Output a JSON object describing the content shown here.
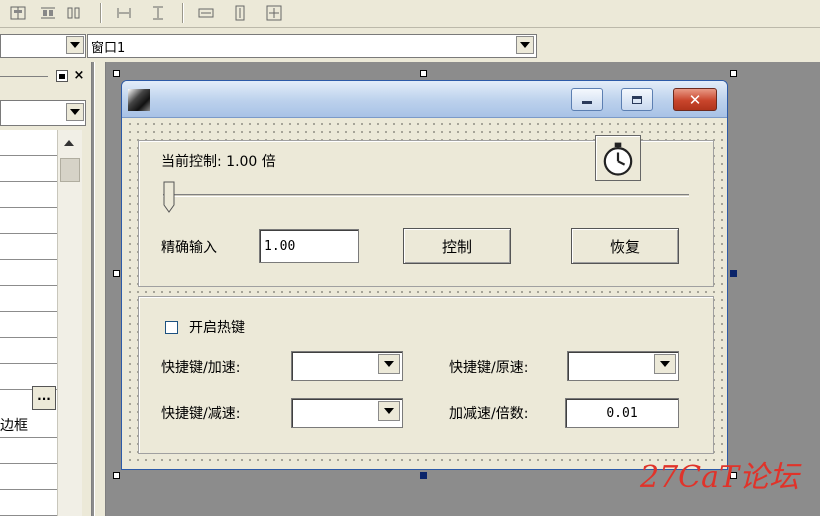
{
  "combo_row": {
    "window_combo_value": "窗口1"
  },
  "left_panel": {
    "ellipsis_label": "...",
    "partial_text": "边框"
  },
  "form": {
    "current_control_label": "当前控制: 1.00 倍",
    "slider_value": 0,
    "precise_input_label": "精确输入",
    "precise_input_value": "1.00",
    "control_button": "控制",
    "restore_button": "恢复",
    "hotkey_checkbox_label": "开启热键",
    "hotkey_checked": false,
    "hotkey_speedup_label": "快捷键/加速:",
    "hotkey_speedup_value": "",
    "hotkey_restore_label": "快捷键/原速:",
    "hotkey_restore_value": "",
    "hotkey_slowdown_label": "快捷键/减速:",
    "hotkey_slowdown_value": "",
    "step_label": "加减速/倍数:",
    "step_value": "0.01"
  },
  "watermark": "27CaT论坛",
  "icons": {
    "toolbar": [
      "align-center-icon",
      "align-middle-icon",
      "align-distribute-icon",
      "space-horizontal-icon",
      "space-vertical-icon",
      "same-width-icon",
      "same-height-icon",
      "same-size-icon"
    ],
    "form_icon": "app-icon",
    "timer_icon": "stopwatch-icon"
  }
}
